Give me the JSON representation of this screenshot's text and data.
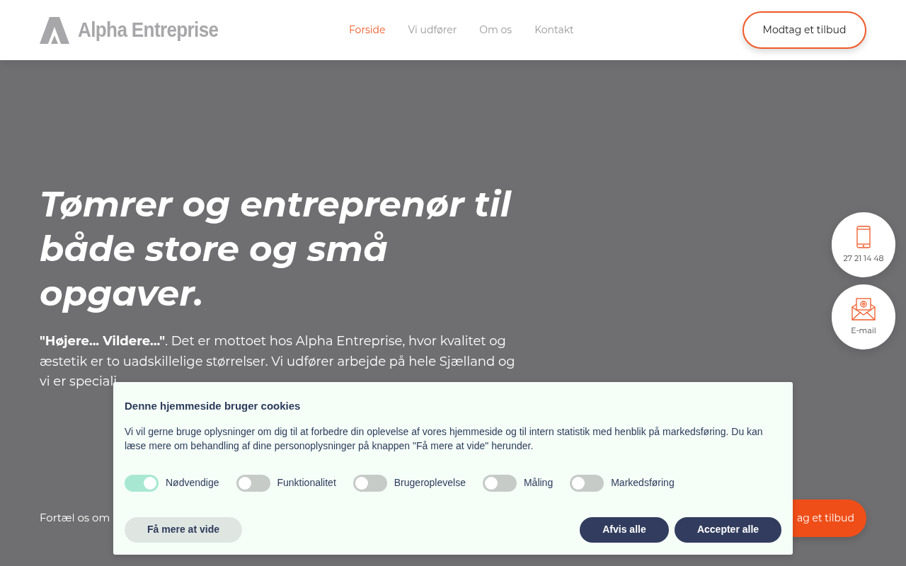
{
  "header": {
    "logo": "Alpha Entreprise",
    "nav": [
      {
        "label": "Forside",
        "selected": true
      },
      {
        "label": "Vi udfører",
        "selected": false
      },
      {
        "label": "Om os",
        "selected": false
      },
      {
        "label": "Kontakt",
        "selected": false
      }
    ],
    "cta": "Modtag et tilbud"
  },
  "hero": {
    "title": "Tømrer og entreprenør til både store og små opgaver.",
    "lead": "**\"Højere... Vildere...\"**. Det er mottoet hos Alpha Entreprise, hvor kvalitet og æstetik er to uadskillelige størrelser. Vi udfører arbejde på hele Sjælland og vi er speciali",
    "footer_text": "Fortæl os om",
    "button": "ag et tilbud"
  },
  "contact": [
    {
      "kind": "phone",
      "label": "27 21 14 48"
    },
    {
      "kind": "email",
      "label": "E-mail"
    }
  ],
  "cookie": {
    "title": "Denne hjemmeside bruger cookies",
    "text": "Vi vil gerne bruge oplysninger om dig til at forbedre din oplevelse af vores hjemmeside og til intern statistik med henblik på markedsføring. Du kan læse mere om behandling af dine personoplysninger på knappen \"Få mere at vide\" herunder.",
    "toggles": [
      {
        "label": "Nødvendige",
        "on": true
      },
      {
        "label": "Funktionalitet",
        "on": false
      },
      {
        "label": "Brugeroplevelse",
        "on": false
      },
      {
        "label": "Måling",
        "on": false
      },
      {
        "label": "Markedsføring",
        "on": false
      }
    ],
    "more": "Få mere at vide",
    "reject": "Afvis alle",
    "accept": "Accepter alle"
  }
}
